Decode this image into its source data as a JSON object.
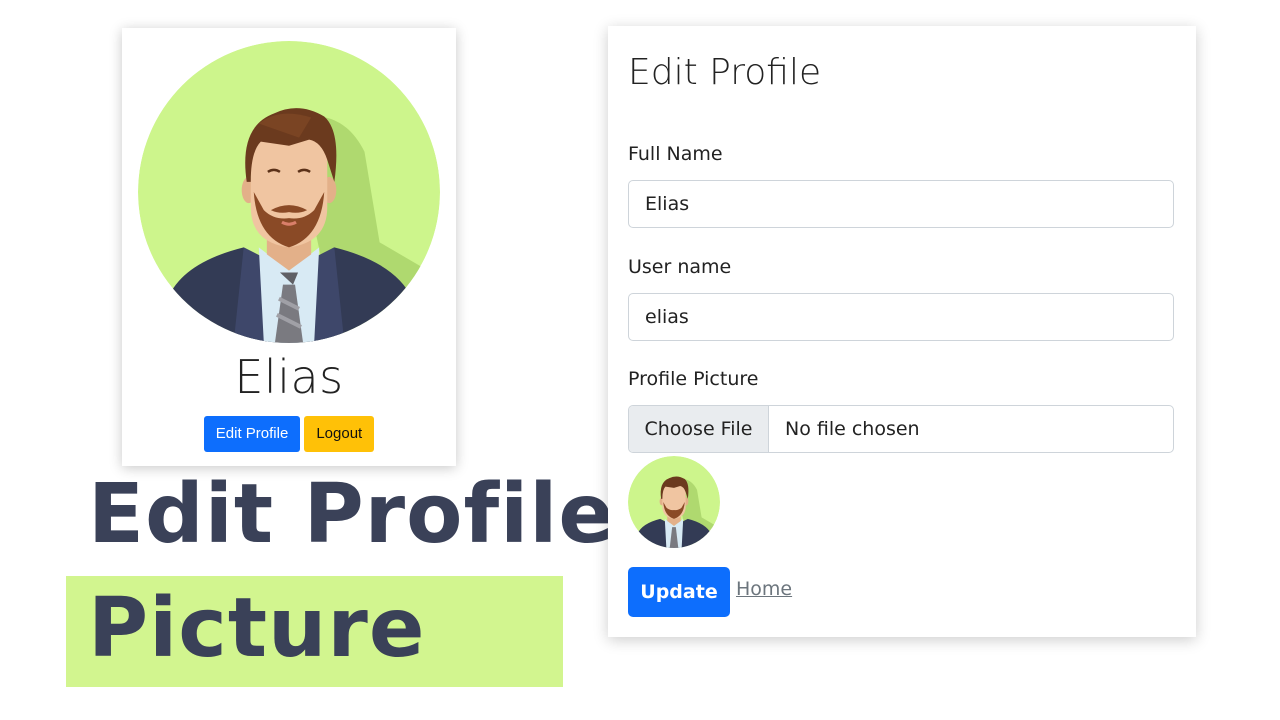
{
  "profile_card": {
    "name": "Elias",
    "edit_button": "Edit Profile",
    "logout_button": "Logout"
  },
  "banner": {
    "title": "Edit Profile",
    "subtitle": "Picture"
  },
  "form": {
    "title": "Edit Profile",
    "full_name_label": "Full Name",
    "full_name_value": "Elias",
    "username_label": "User name",
    "username_value": "elias",
    "picture_label": "Profile Picture",
    "choose_file_label": "Choose File",
    "file_status": "No file chosen",
    "update_button": "Update",
    "home_link": "Home"
  },
  "colors": {
    "primary": "#0d6efd",
    "warning": "#ffc107",
    "avatar_bg": "#cdf58c",
    "banner_highlight": "#d2f58f",
    "banner_text": "#3a4158"
  },
  "icons": {
    "avatar": "man-avatar-icon"
  }
}
